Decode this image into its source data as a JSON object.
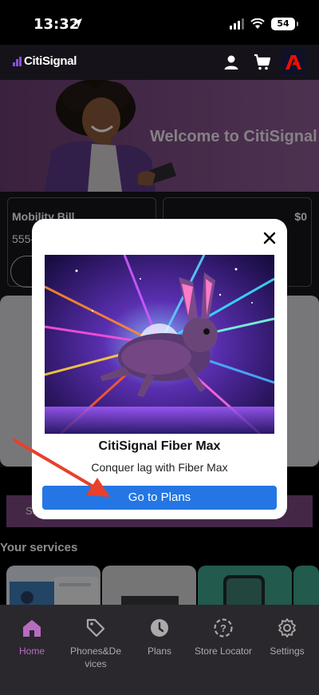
{
  "status_bar": {
    "time": "13:32",
    "battery": "54"
  },
  "header": {
    "app_name": "CitiSignal"
  },
  "hero": {
    "title": "Welcome to CitiSignal"
  },
  "bill_cards": [
    {
      "title": "Mobility Bill",
      "number": "555-"
    },
    {
      "amount": "$0"
    }
  ],
  "promo_bar": {
    "label": "Su"
  },
  "services": {
    "title": "Your services"
  },
  "modal": {
    "title": "CitiSignal Fiber Max",
    "subtitle": "Conquer lag with Fiber Max",
    "button_label": "Go to Plans"
  },
  "bottom_nav": {
    "items": [
      {
        "label": "Home",
        "icon": "home-icon",
        "active": true
      },
      {
        "label": "Phones&Devices",
        "icon": "tag-icon",
        "active": false
      },
      {
        "label": "Plans",
        "icon": "clock-icon",
        "active": false
      },
      {
        "label": "Store Locator",
        "icon": "location-question-icon",
        "active": false
      },
      {
        "label": "Settings",
        "icon": "gear-icon",
        "active": false
      }
    ]
  },
  "colors": {
    "brand_purple": "#7d4780",
    "button_blue": "#2376e4",
    "nav_active": "#b86cc0",
    "arrow_red": "#e8402a"
  }
}
